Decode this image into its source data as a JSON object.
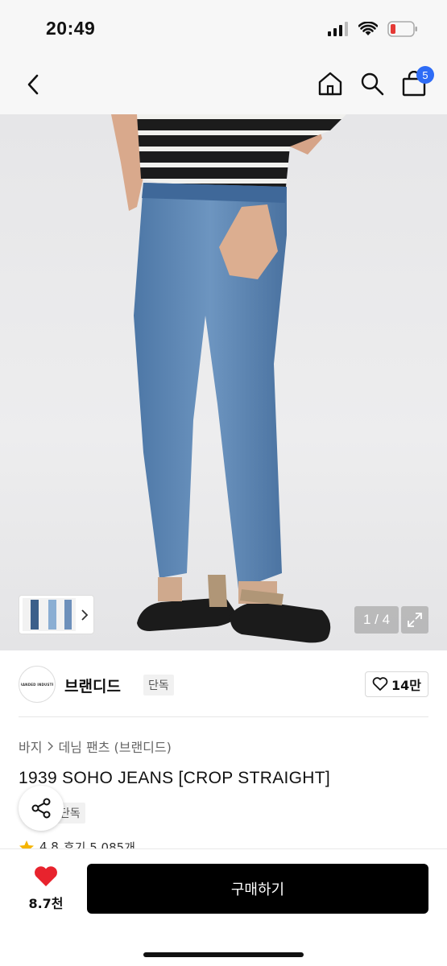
{
  "status": {
    "time": "20:49",
    "battery_color": "#e53935"
  },
  "nav": {
    "back_icon": "chevron-left-icon",
    "cart_count": "5",
    "badge_color": "#2e6cf6"
  },
  "gallery": {
    "counter": "1 / 4"
  },
  "brand": {
    "name": "브랜디드",
    "exclusive": "단독",
    "likes": "14만",
    "logo_text": "BRANDED INDUSTRY"
  },
  "breadcrumb": {
    "level1": "바지",
    "level2": "데님 팬츠 (브랜디드)"
  },
  "product": {
    "title": "1939 SOHO JEANS [CROP STRAIGHT]",
    "exclusive": "단독"
  },
  "rating": {
    "score": "4.8",
    "reviews": "후기 5,085개",
    "star_color": "#f5b400"
  },
  "bottom": {
    "wish_count": "8.7천",
    "buy_label": "구매하기",
    "heart_color": "#e8232d"
  }
}
